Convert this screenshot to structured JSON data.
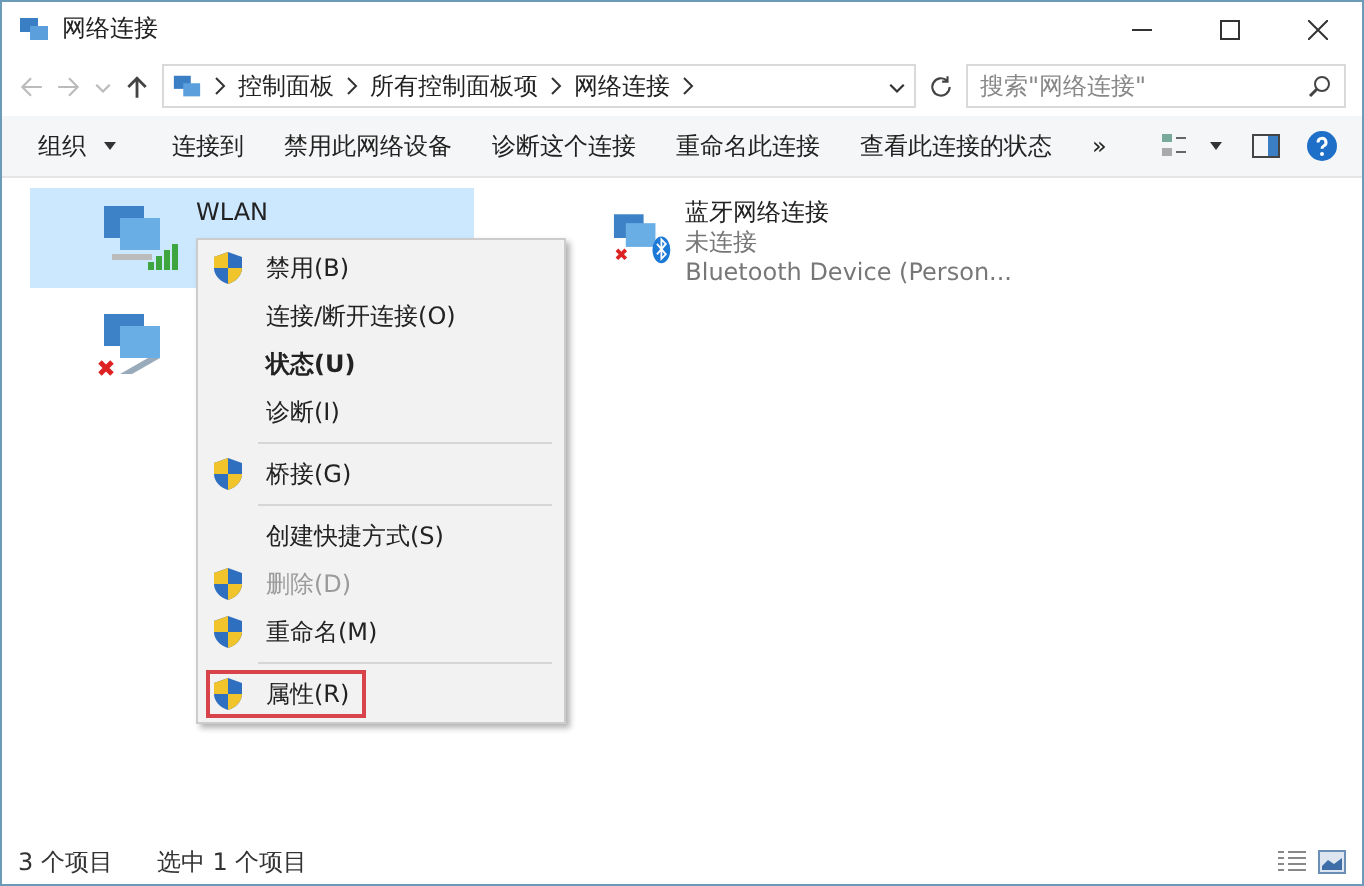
{
  "window": {
    "title": "网络连接"
  },
  "address": {
    "crumbs": [
      "控制面板",
      "所有控制面板项",
      "网络连接"
    ]
  },
  "search": {
    "placeholder": "搜索\"网络连接\""
  },
  "toolbar": [
    {
      "label": "组织",
      "dropdown": true
    },
    {
      "label": "连接到",
      "dropdown": false
    },
    {
      "label": "禁用此网络设备",
      "dropdown": false
    },
    {
      "label": "诊断这个连接",
      "dropdown": false
    },
    {
      "label": "重命名此连接",
      "dropdown": false
    },
    {
      "label": "查看此连接的状态",
      "dropdown": false
    },
    {
      "label": "»",
      "dropdown": false
    }
  ],
  "connections": [
    {
      "kind": "wifi",
      "name": "WLAN",
      "selected": true
    },
    {
      "kind": "bluetooth",
      "name": "蓝牙网络连接",
      "lines": [
        "未连接",
        "Bluetooth Device (Person..."
      ],
      "selected": false
    },
    {
      "kind": "ethernet",
      "selected": false
    }
  ],
  "context_menu": [
    {
      "kind": "item",
      "label": "禁用(B)",
      "shield": true,
      "disabled": false,
      "bold": false,
      "outlined": false
    },
    {
      "kind": "item",
      "label": "连接/断开连接(O)",
      "shield": false,
      "disabled": false,
      "bold": false,
      "outlined": false
    },
    {
      "kind": "item",
      "label": "状态(U)",
      "shield": false,
      "disabled": false,
      "bold": true,
      "outlined": false
    },
    {
      "kind": "item",
      "label": "诊断(I)",
      "shield": false,
      "disabled": false,
      "bold": false,
      "outlined": false
    },
    {
      "kind": "separator"
    },
    {
      "kind": "item",
      "label": "桥接(G)",
      "shield": true,
      "disabled": false,
      "bold": false,
      "outlined": false
    },
    {
      "kind": "separator"
    },
    {
      "kind": "item",
      "label": "创建快捷方式(S)",
      "shield": false,
      "disabled": false,
      "bold": false,
      "outlined": false
    },
    {
      "kind": "item",
      "label": "删除(D)",
      "shield": true,
      "disabled": true,
      "bold": false,
      "outlined": false
    },
    {
      "kind": "item",
      "label": "重命名(M)",
      "shield": true,
      "disabled": false,
      "bold": false,
      "outlined": false
    },
    {
      "kind": "separator"
    },
    {
      "kind": "item",
      "label": "属性(R)",
      "shield": true,
      "disabled": false,
      "bold": false,
      "outlined": true
    }
  ],
  "status_bar": [
    "3 个项目",
    "选中 1 个项目"
  ]
}
